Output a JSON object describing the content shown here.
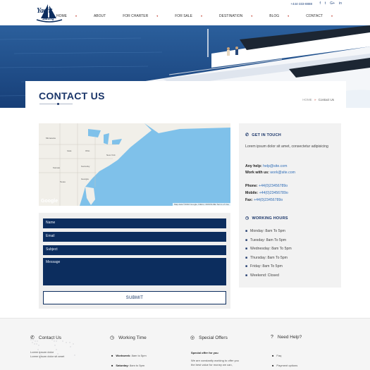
{
  "header": {
    "logo_text": "Yacht",
    "logo_sub": "Sailing",
    "phone": "+444-333-8888",
    "social": [
      "f",
      "t",
      "G+",
      "in"
    ],
    "nav": [
      {
        "label": "HOME",
        "caret": true
      },
      {
        "label": "ABOUT",
        "caret": false
      },
      {
        "label": "FOR CHARTER",
        "caret": true
      },
      {
        "label": "FOR SALE",
        "caret": true
      },
      {
        "label": "DESTINATION",
        "caret": true
      },
      {
        "label": "BLOG",
        "caret": true
      },
      {
        "label": "CONTACT",
        "caret": true
      }
    ]
  },
  "title": {
    "page_title": "CONTACT US",
    "crumb_home": "HOME",
    "crumb_sep": "»",
    "crumb_current": "Contact Us"
  },
  "map": {
    "logo": "Google",
    "attribution": "Map data ©2016 Google, INEGI, ORION-ME   Terms of Use"
  },
  "contact": {
    "heading": "GET IN TOUCH",
    "intro": "Lorem ipsum dolor sit amet, consectetur adipisicing",
    "help_label": "Any help:",
    "help_email": "help@site.com",
    "work_label": "Work with us:",
    "work_email": "work@site.com",
    "phone_label": "Phone:",
    "phone_value": "+44(0)23456789o",
    "mobile_label": "Mobile:",
    "mobile_value": "+44(0)23456789o",
    "fax_label": "Fax:",
    "fax_value": "+44(0)23456789o"
  },
  "hours": {
    "heading": "WORKING HOURS",
    "items": [
      "Monday: 8am To 5pm",
      "Tuesday: 8am To 5pm",
      "Wednesday: 8am To 5pm",
      "Thursday: 8am To 5pm",
      "Friday: 8am To 5pm",
      "Weekend: Closed"
    ]
  },
  "form": {
    "name_placeholder": "Name",
    "email_placeholder": "Email",
    "subject_placeholder": "Subject",
    "message_placeholder": "Message",
    "submit_label": "SUBMIT"
  },
  "footer": {
    "contact_heading": "Contact Us",
    "contact_line1": "Lorem ipsum dolor",
    "contact_line2": "Lorem ipsum dolor sit amet",
    "time_heading": "Working Time",
    "time_line1_label": "Workweek:",
    "time_line1_value": "8am to 5pm",
    "time_line2_label": "Saturday:",
    "time_line2_value": "8am to 5pm",
    "offers_heading": "Special Offers",
    "offers_title": "Special offer for you",
    "offers_line1": "We are constantly working to offer you",
    "offers_line2": "the best value for money we can,",
    "help_heading": "Need Help?",
    "help_link1": "Faq",
    "help_link2": "Payment options"
  }
}
